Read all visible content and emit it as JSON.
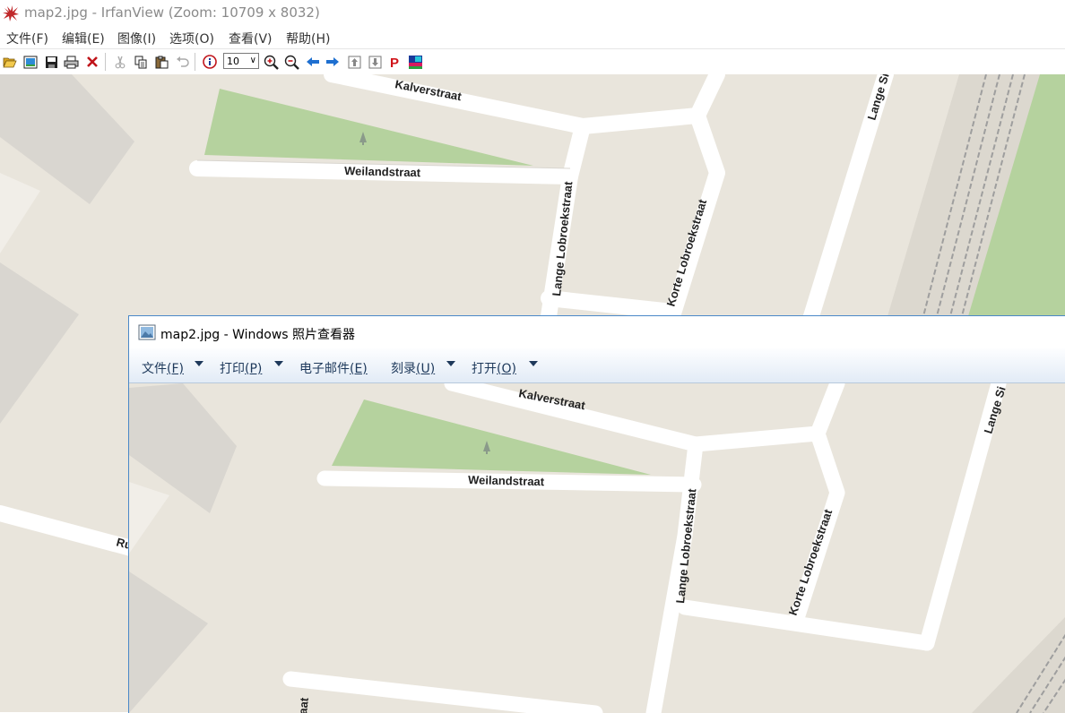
{
  "irfanview": {
    "window_title": "map2.jpg - IrfanView (Zoom: 10709 x 8032)",
    "menu": [
      "文件(F)",
      "编辑(E)",
      "图像(I)",
      "选项(O)",
      "查看(V)",
      "帮助(H)"
    ],
    "toolbar": {
      "zoom_value": "10",
      "icons": [
        "open-icon",
        "thumbnails-icon",
        "save-icon",
        "print-icon",
        "delete-icon",
        "cut-icon",
        "copy-icon",
        "paste-icon",
        "undo-icon",
        "info-icon",
        "zoom-in-icon",
        "zoom-out-icon",
        "previous-icon",
        "next-icon",
        "first-icon",
        "last-icon",
        "pdf-icon",
        "slideshow-icon"
      ]
    }
  },
  "map_labels": {
    "kalverstraat": "Kalverstraat",
    "weilandstraat": "Weilandstraat",
    "lange_lobroekstraat": "Lange Lobroekstraat",
    "korte_lobroekstraat": "Korte Lobroekstraat",
    "lange_s": "Lange Si",
    "ru": "Ru",
    "aat": "aat"
  },
  "photo_viewer": {
    "window_title": "map2.jpg - Windows 照片查看器",
    "commands": [
      {
        "label": "文件",
        "key": "(F)"
      },
      {
        "label": "打印",
        "key": "(P)"
      },
      {
        "label": "电子邮件",
        "key": "(E)"
      },
      {
        "label": "刻录",
        "key": "(U)"
      },
      {
        "label": "打开",
        "key": "(O)"
      }
    ]
  },
  "colors": {
    "map_land": "#e9e5dc",
    "map_road": "#ffffff",
    "map_park": "#b5d29e",
    "map_building": "#d9d6d0",
    "accent": "#4a88c8"
  }
}
